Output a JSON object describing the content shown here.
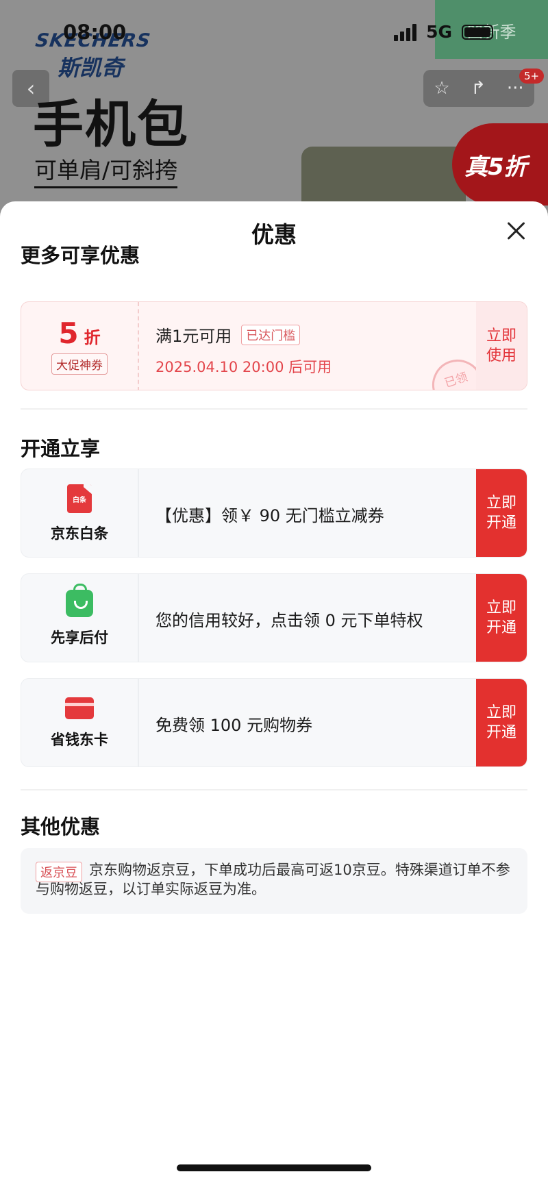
{
  "status_bar": {
    "time": "08:00",
    "network": "5G"
  },
  "background": {
    "brand_en": "SKECHERS",
    "brand_cn": "斯凯奇",
    "green_tag": "凹新季",
    "product_title": "手机包",
    "product_subtitle": "可单肩/可斜挎",
    "promo_badge": "真5折",
    "notification_count": "5+"
  },
  "sheet": {
    "title": "优惠",
    "section_more": "更多可享优惠",
    "coupon": {
      "discount_value": "5",
      "discount_unit": "折",
      "coupon_type": "大促神券",
      "condition": "满1元可用",
      "reached_tag": "已达门槛",
      "available_time": "2025.04.10 20:00 后可用",
      "action_label": "立即使用",
      "stamp": "已领"
    },
    "section_activate": "开通立享",
    "services": [
      {
        "name": "京东白条",
        "icon": "baitiao-icon",
        "icon_text": "白条",
        "text": "【优惠】领￥ 90 无门槛立减券",
        "action_label": "立即开通"
      },
      {
        "name": "先享后付",
        "icon": "shopping-bag-icon",
        "text": "您的信用较好，点击领 0 元下单特权",
        "action_label": "立即开通"
      },
      {
        "name": "省钱东卡",
        "icon": "card-icon",
        "text": "免费领 100 元购物券",
        "action_label": "立即开通"
      }
    ],
    "section_other": "其他优惠",
    "other": {
      "tag": "返京豆",
      "text": "京东购物返京豆，下单成功后最高可返10京豆。特殊渠道订单不参与购物返豆，以订单实际返豆为准。"
    }
  },
  "colors": {
    "accent_red": "#e3312f",
    "coupon_bg": "#fff4f4",
    "service_bg": "#f7f8fa"
  }
}
